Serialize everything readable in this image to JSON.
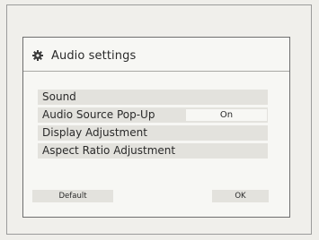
{
  "dialog": {
    "title": "Audio settings",
    "title_icon": "gear-icon"
  },
  "menu": {
    "items": [
      {
        "label": "Sound",
        "value": ""
      },
      {
        "label": "Audio Source Pop-Up",
        "value": "On"
      },
      {
        "label": "Display Adjustment",
        "value": ""
      },
      {
        "label": "Aspect Ratio Adjustment",
        "value": ""
      }
    ]
  },
  "buttons": {
    "default_label": "Default",
    "ok_label": "OK"
  }
}
